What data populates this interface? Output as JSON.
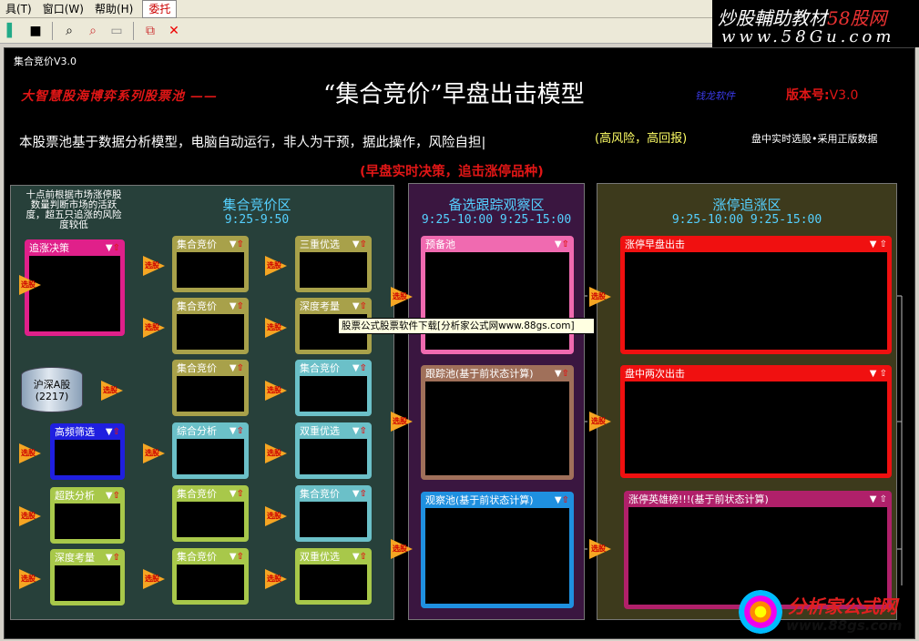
{
  "menubar": {
    "items": [
      "具(T)",
      "窗口(W)",
      "帮助(H)"
    ],
    "highlight": "委托"
  },
  "brand": {
    "line1_a": "炒股輔助教材",
    "line1_b": "58股网",
    "line2": "www.58Gu.com"
  },
  "window_title": "集合竞价V3.0",
  "headline": "大智慧股海博弈系列股票池 ——",
  "title": "“集合竞价”早盘出击模型",
  "brand_small": "钱龙软件",
  "version_label": "版本号:",
  "version_value": "V3.0",
  "description": "本股票池基于数据分析模型，电脑自动运行，非人为干预，据此操作，风险自担|",
  "risk": "(高风险，高回报)",
  "realtime": "盘中实时选股•采用正版数据",
  "strategy": "(早盘实时决策，追击涨停品种)",
  "note": "十点前根据市场涨停股数量判断市场的活跃度，超五只追涨的风险度较低",
  "zones": [
    {
      "title": "集合竞价区",
      "time": "9:25-9:50"
    },
    {
      "title": "备选跟踪观察区",
      "time": "9:25-10:00 9:25-15:00"
    },
    {
      "title": "涨停追涨区",
      "time": "9:25-10:00 9:25-15:00"
    }
  ],
  "source": {
    "label": "沪深A股",
    "count": "(2217)"
  },
  "arrow_label": "选股",
  "boxes": [
    {
      "title": "追涨决策",
      "color": "#e0208a"
    },
    {
      "title": "高频筛选",
      "color": "#1f1fe0"
    },
    {
      "title": "超跌分析",
      "color": "#a8c84a"
    },
    {
      "title": "深度考量",
      "color": "#a8c84a"
    },
    {
      "title": "集合竞价",
      "color": "#a8a14a"
    },
    {
      "title": "集合竞价",
      "color": "#a8a14a"
    },
    {
      "title": "集合竞价",
      "color": "#a8a14a"
    },
    {
      "title": "综合分析",
      "color": "#6bc0c8"
    },
    {
      "title": "集合竞价",
      "color": "#a8c84a"
    },
    {
      "title": "集合竞价",
      "color": "#a8c84a"
    },
    {
      "title": "三重优选",
      "color": "#a8a14a"
    },
    {
      "title": "深度考量",
      "color": "#a8a14a"
    },
    {
      "title": "集合竞价",
      "color": "#6bc0c8"
    },
    {
      "title": "双重优选",
      "color": "#6bc0c8"
    },
    {
      "title": "集合竞价",
      "color": "#6bc0c8"
    },
    {
      "title": "双重优选",
      "color": "#a8c84a"
    },
    {
      "title": "预备池",
      "color": "#f06ab0"
    },
    {
      "title": "跟踪池(基于前状态计算)",
      "color": "#a0705a"
    },
    {
      "title": "观察池(基于前状态计算)",
      "color": "#1f90e0"
    },
    {
      "title": "涨停早盘出击",
      "color": "#f01010"
    },
    {
      "title": "盘中两次出击",
      "color": "#f01010"
    },
    {
      "title": "涨停英雄榜!!!(基于前状态计算)",
      "color": "#b0206a"
    }
  ],
  "tooltip": "股票公式股票软件下载[分析家公式网www.88gs.com]",
  "watermark": {
    "name": "分析家公式网",
    "url": "www.88gs.com"
  }
}
